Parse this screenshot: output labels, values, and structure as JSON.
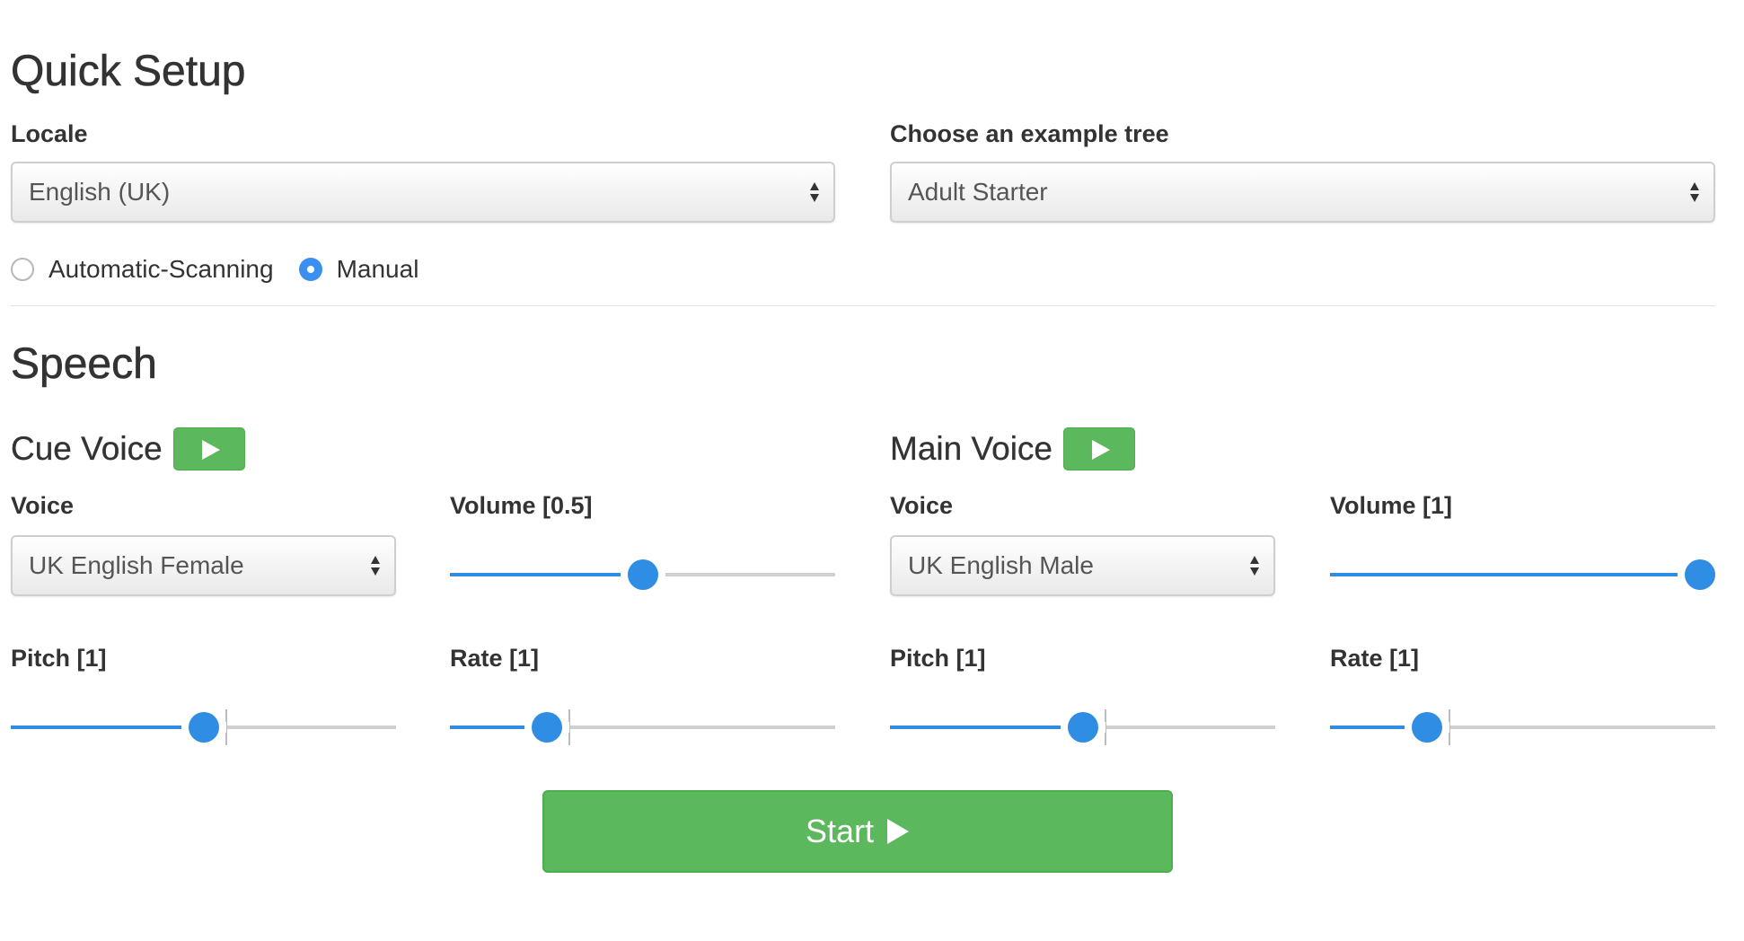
{
  "quick_setup": {
    "title": "Quick Setup",
    "locale": {
      "label": "Locale",
      "value": "English (UK)"
    },
    "tree": {
      "label": "Choose an example tree",
      "value": "Adult Starter"
    },
    "mode": {
      "options": [
        {
          "label": "Automatic-Scanning",
          "checked": false
        },
        {
          "label": "Manual",
          "checked": true
        }
      ]
    }
  },
  "speech": {
    "title": "Speech",
    "cue_voice": {
      "title": "Cue Voice",
      "voice_label": "Voice",
      "voice_value": "UK English Female",
      "volume_label": "Volume [0.5]",
      "volume_value": 0.5,
      "pitch_label": "Pitch [1]",
      "pitch_value": 1,
      "rate_label": "Rate [1]",
      "rate_value": 1
    },
    "main_voice": {
      "title": "Main Voice",
      "voice_label": "Voice",
      "voice_value": "UK English Male",
      "volume_label": "Volume [1]",
      "volume_value": 1,
      "pitch_label": "Pitch [1]",
      "pitch_value": 1,
      "rate_label": "Rate [1]",
      "rate_value": 1
    }
  },
  "start_button": {
    "label": "Start"
  },
  "colors": {
    "accent": "#2f8de4",
    "success": "#5cb85c",
    "radio_checked": "#3b8ff0"
  },
  "icons": {
    "play": "play-icon",
    "select_arrows": "select-arrows-icon"
  }
}
